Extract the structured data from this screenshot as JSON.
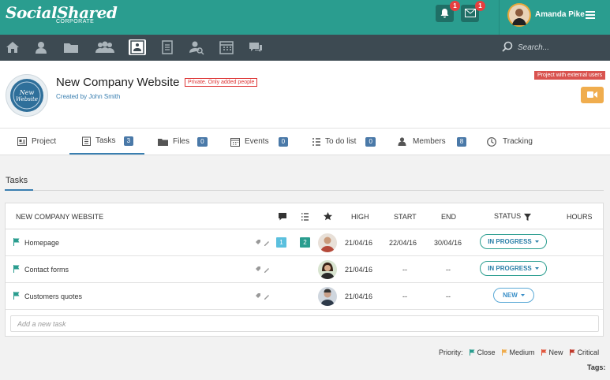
{
  "app": {
    "logo": "SocialShared",
    "logo_sub": "CORPORATE"
  },
  "topbar": {
    "notifications_count": "1",
    "messages_count": "1",
    "user_name": "Amanda Pike"
  },
  "nav": {
    "items": [
      "home-icon",
      "user-icon",
      "folder-icon",
      "group-icon",
      "org-chart-icon",
      "clipboard-icon",
      "user-search-icon",
      "calendar-icon",
      "chat-icon"
    ],
    "search_placeholder": "Search..."
  },
  "project": {
    "logo_text": "New Website",
    "title": "New Company Website",
    "privacy_badge": "Private. Only added people",
    "created_by": "Created by John Smith",
    "external_badge": "Project with external users"
  },
  "tabs": [
    {
      "label": "Project",
      "count": ""
    },
    {
      "label": "Tasks",
      "count": "3"
    },
    {
      "label": "Files",
      "count": "0"
    },
    {
      "label": "Events",
      "count": "0"
    },
    {
      "label": "To do list",
      "count": "0"
    },
    {
      "label": "Members",
      "count": "8"
    },
    {
      "label": "Tracking",
      "count": ""
    }
  ],
  "section": {
    "title": "Tasks"
  },
  "table": {
    "group_title": "NEW COMPANY WEBSITE",
    "headers": {
      "high": "HIGH",
      "start": "START",
      "end": "END",
      "status": "STATUS",
      "hours": "HOURS"
    },
    "rows": [
      {
        "name": "Homepage",
        "comments": "1",
        "subtasks": "2",
        "high": "21/04/16",
        "start": "22/04/16",
        "end": "30/04/16",
        "status": "IN PROGRESS"
      },
      {
        "name": "Contact forms",
        "comments": "",
        "subtasks": "",
        "high": "21/04/16",
        "start": "--",
        "end": "--",
        "status": "IN PROGRESS"
      },
      {
        "name": "Customers quotes",
        "comments": "",
        "subtasks": "",
        "high": "21/04/16",
        "start": "--",
        "end": "--",
        "status": "NEW"
      }
    ],
    "add_placeholder": "Add a new task"
  },
  "legend": {
    "label": "Priority:",
    "items": [
      {
        "label": "Close",
        "color": "#2a9d8f"
      },
      {
        "label": "Medium",
        "color": "#f0ad4e"
      },
      {
        "label": "New",
        "color": "#e2583e"
      },
      {
        "label": "Critical",
        "color": "#c0392b"
      }
    ],
    "tags_label": "Tags:"
  },
  "colors": {
    "brand": "#2a9d8f",
    "nav": "#3d4a52",
    "accent": "#3a7fb0"
  }
}
